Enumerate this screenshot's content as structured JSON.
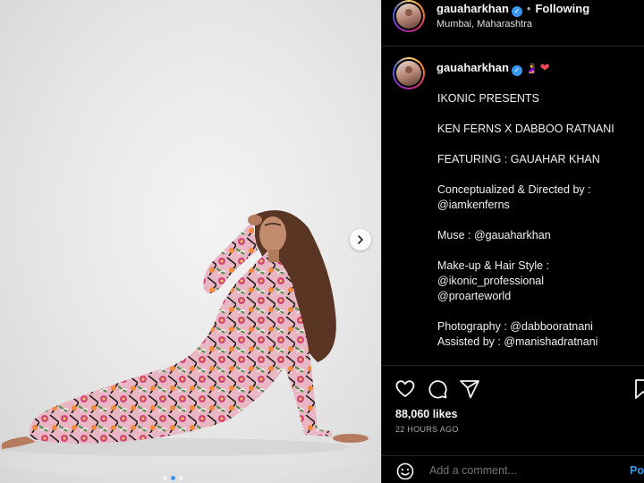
{
  "header": {
    "username": "gauaharkhan",
    "separator": "•",
    "follow_status": "Following",
    "location": "Mumbai, Maharashtra"
  },
  "caption": {
    "username": "gauaharkhan",
    "emoji": "🤰",
    "heart": "❤",
    "lines": [
      "IKONIC PRESENTS",
      "",
      "KEN FERNS X DABBOO RATNANI",
      "",
      "FEATURING : GAUAHAR KHAN",
      "",
      "Conceptualized & Directed by :",
      "@iamkenferns",
      "",
      "Muse : @gauaharkhan",
      "",
      "Make-up & Hair Style :",
      "@ikonic_professional",
      "@proarteworld",
      "",
      "Photography : @dabbooratnani",
      "Assisted by : @manishadratnani"
    ]
  },
  "post": {
    "likes": "88,060 likes",
    "time": "22 HOURS AGO"
  },
  "comment": {
    "placeholder": "Add a comment...",
    "post_label": "Post"
  },
  "carousel": {
    "dots": 3,
    "active_index": 1
  },
  "colors": {
    "accent": "#3897f0",
    "heart": "#ed4956",
    "background": "#000000",
    "muted_text": "#a8a8a8"
  }
}
